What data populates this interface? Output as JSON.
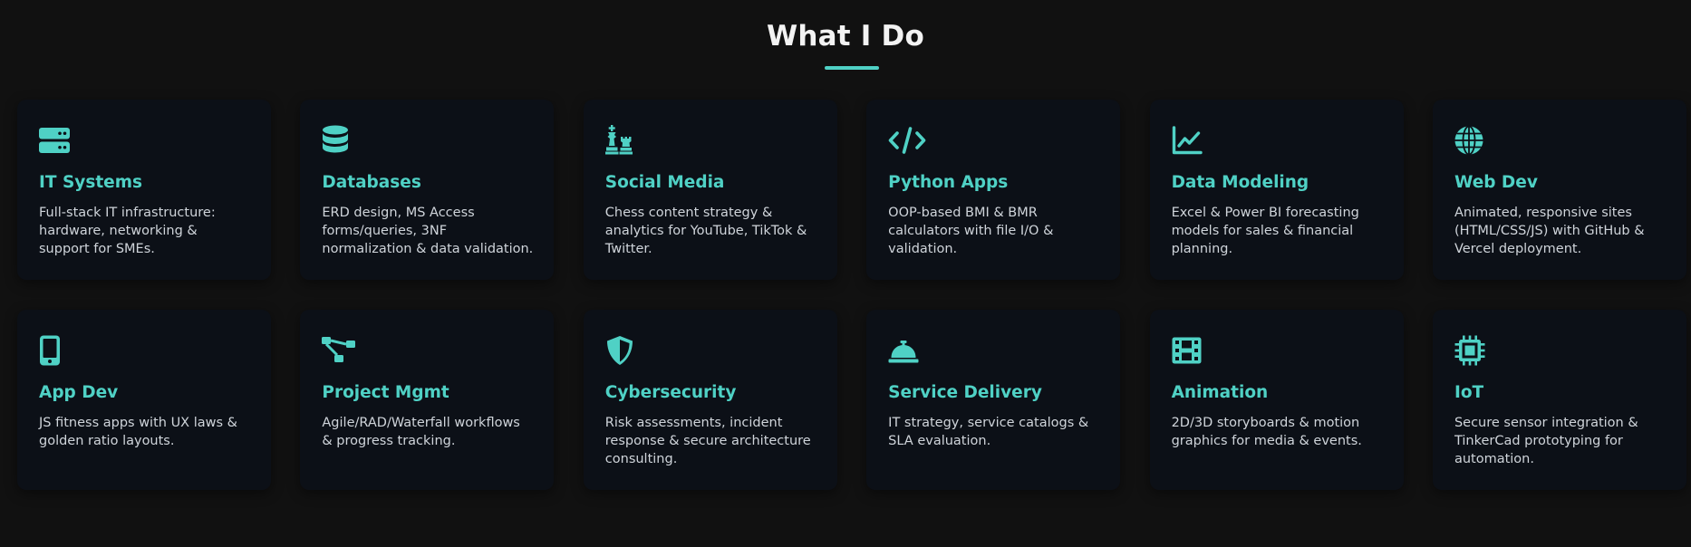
{
  "section": {
    "title": "What I Do"
  },
  "colors": {
    "accent": "#4fd1c5",
    "background": "#111111",
    "card": "#0c1017",
    "text": "#cfd4da"
  },
  "services": [
    {
      "icon": "server-icon",
      "title": "IT Systems",
      "desc": "Full-stack IT infrastructure: hardware, networking & support for SMEs."
    },
    {
      "icon": "database-icon",
      "title": "Databases",
      "desc": "ERD design, MS Access forms/queries, 3NF normalization & data validation."
    },
    {
      "icon": "chess-icon",
      "title": "Social Media",
      "desc": "Chess content strategy & analytics for YouTube, TikTok & Twitter."
    },
    {
      "icon": "code-icon",
      "title": "Python Apps",
      "desc": "OOP-based BMI & BMR calculators with file I/O & validation."
    },
    {
      "icon": "chart-line-icon",
      "title": "Data Modeling",
      "desc": "Excel & Power BI forecasting models for sales & financial planning."
    },
    {
      "icon": "globe-icon",
      "title": "Web Dev",
      "desc": "Animated, responsive sites (HTML/CSS/JS) with GitHub & Vercel deployment."
    },
    {
      "icon": "mobile-icon",
      "title": "App Dev",
      "desc": "JS fitness apps with UX laws & golden ratio layouts."
    },
    {
      "icon": "project-diagram-icon",
      "title": "Project Mgmt",
      "desc": "Agile/RAD/Waterfall workflows & progress tracking."
    },
    {
      "icon": "shield-icon",
      "title": "Cybersecurity",
      "desc": "Risk assessments, incident response & secure architecture consulting."
    },
    {
      "icon": "concierge-bell-icon",
      "title": "Service Delivery",
      "desc": "IT strategy, service catalogs & SLA evaluation."
    },
    {
      "icon": "film-icon",
      "title": "Animation",
      "desc": "2D/3D storyboards & motion graphics for media & events."
    },
    {
      "icon": "microchip-icon",
      "title": "IoT",
      "desc": "Secure sensor integration & TinkerCad prototyping for automation."
    }
  ]
}
